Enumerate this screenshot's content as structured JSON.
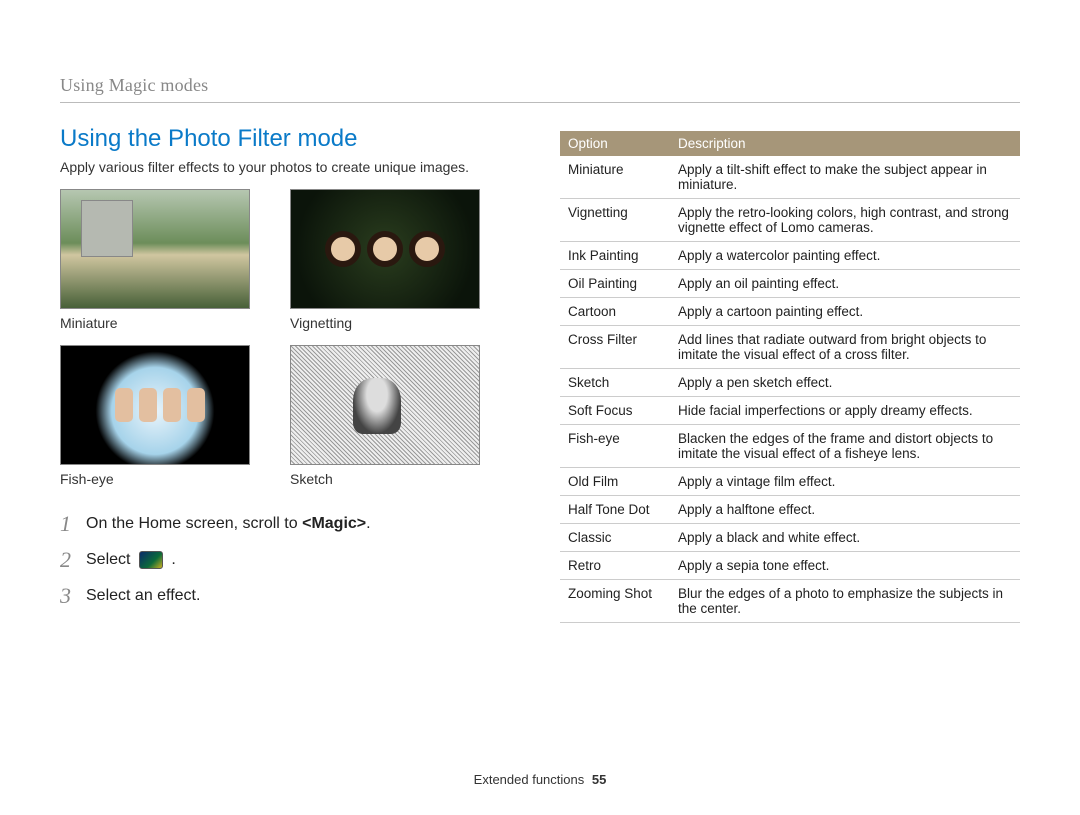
{
  "breadcrumb": "Using Magic modes",
  "section_title": "Using the Photo Filter mode",
  "intro": "Apply various filter effects to your photos to create unique images.",
  "thumbs": {
    "r1c1": "Miniature",
    "r1c2": "Vignetting",
    "r2c1": "Fish-eye",
    "r2c2": "Sketch"
  },
  "steps": {
    "s1_num": "1",
    "s1_prefix": "On the Home screen, scroll to ",
    "s1_bold": "<Magic>",
    "s1_suffix": ".",
    "s2_num": "2",
    "s2_prefix": "Select ",
    "s2_suffix": ".",
    "s3_num": "3",
    "s3_text": "Select an effect."
  },
  "table": {
    "headers": {
      "option": "Option",
      "description": "Description"
    },
    "rows": [
      {
        "option": "Miniature",
        "description": "Apply a tilt-shift effect to make the subject appear in miniature."
      },
      {
        "option": "Vignetting",
        "description": "Apply the retro-looking colors, high contrast, and strong vignette effect of Lomo cameras."
      },
      {
        "option": "Ink Painting",
        "description": "Apply a watercolor painting effect."
      },
      {
        "option": "Oil Painting",
        "description": "Apply an oil painting effect."
      },
      {
        "option": "Cartoon",
        "description": "Apply a cartoon painting effect."
      },
      {
        "option": "Cross Filter",
        "description": "Add lines that radiate outward from bright objects to imitate the visual effect of a cross filter."
      },
      {
        "option": "Sketch",
        "description": "Apply a pen sketch effect."
      },
      {
        "option": "Soft Focus",
        "description": "Hide facial imperfections or apply dreamy effects."
      },
      {
        "option": "Fish-eye",
        "description": "Blacken the edges of the frame and distort objects to imitate the visual effect of a fisheye lens."
      },
      {
        "option": "Old Film",
        "description": "Apply a vintage film effect."
      },
      {
        "option": "Half Tone Dot",
        "description": "Apply a halftone effect."
      },
      {
        "option": "Classic",
        "description": "Apply a black and white effect."
      },
      {
        "option": "Retro",
        "description": "Apply a sepia tone effect."
      },
      {
        "option": "Zooming Shot",
        "description": "Blur the edges of a photo to emphasize the subjects in the center."
      }
    ]
  },
  "footer": {
    "section": "Extended functions",
    "page": "55"
  }
}
